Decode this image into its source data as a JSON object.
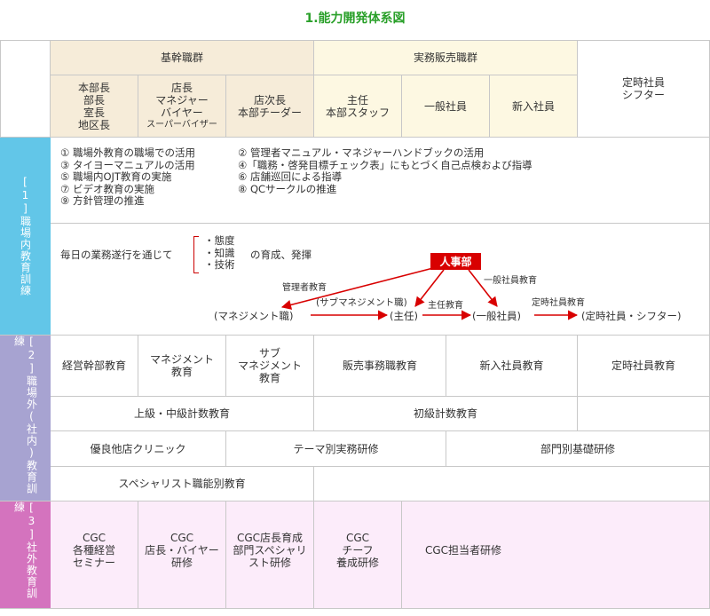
{
  "title": "1.能力開発体系図",
  "header": {
    "group1": "基幹職群",
    "group2": "実務販売職群",
    "parttime": "定時社員\nシフター",
    "cols": [
      {
        "text": "本部長\n部長\n室長\n地区長",
        "sub": ""
      },
      {
        "text": "店長\nマネジャー\nバイヤー",
        "sub": "スーパーバイザー"
      },
      {
        "text": "店次長\n本部チーダー",
        "sub": ""
      },
      {
        "text": "主任\n本部スタッフ",
        "sub": ""
      },
      {
        "text": "一般社員",
        "sub": ""
      },
      {
        "text": "新入社員",
        "sub": ""
      }
    ]
  },
  "sections": {
    "s1": {
      "num": "[1]",
      "label": "職場内教育訓練"
    },
    "s2": {
      "num": "[2]",
      "label": "職場外(社内)教育訓練"
    },
    "s3": {
      "num": "[3]",
      "label": "社外教育訓練"
    }
  },
  "s1_items_left": [
    "① 職場外教育の職場での活用",
    "③ タイヨーマニュアルの活用",
    "⑤ 職場内OJT教育の実施",
    "⑦ ビデオ教育の実施",
    "⑨ 方針管理の推進"
  ],
  "s1_items_right": [
    "② 管理者マニュアル・マネジャーハンドブックの活用",
    "④「職務・啓発目標チェック表」にもとづく自己点検および指導",
    "⑥ 店舗巡回による指導",
    "⑧ QCサークルの推進"
  ],
  "daily": {
    "intro": "毎日の業務遂行を通じて",
    "items": [
      "・態度",
      "・知識",
      "・技術"
    ],
    "suffix": "の育成、発揮"
  },
  "flow": {
    "hr": "人事部",
    "targets": [
      "(マネジメント職)",
      "(主任)",
      "(一般社員)",
      "(定時社員・シフター)"
    ],
    "sub_mgmt": "(サブマネジメント職)",
    "edges": [
      "管理者教育",
      "主任教育",
      "一般社員教育",
      "定時社員教育"
    ]
  },
  "s2_rows": {
    "r1": [
      "経営幹部教育",
      "マネジメント\n教育",
      "サブ\nマネジメント\n教育",
      "販売事務職教育",
      "新入社員教育",
      "定時社員教育"
    ],
    "r2": [
      "上級・中級計数教育",
      "初級計数教育"
    ],
    "r3": [
      "優良他店クリニック",
      "テーマ別実務研修",
      "部門別基礎研修"
    ],
    "r4": [
      "スペシャリスト職能別教育"
    ]
  },
  "s3_row": [
    "CGC\n各種経営\nセミナー",
    "CGC\n店長・バイヤー\n研修",
    "CGC店長育成\n部門スペシャリ\nスト研修",
    "CGC\nチーフ\n養成研修",
    "CGC担当者研修"
  ],
  "colors": {
    "title": "#2aa02a",
    "s1": "#62c6e8",
    "s2": "#a7a3d1",
    "s3": "#d473be",
    "header_tan": "#f6ecd9",
    "header_yellow": "#fdf8e2",
    "s3_bg": "#fcecfa",
    "hr_red": "#d80000"
  }
}
